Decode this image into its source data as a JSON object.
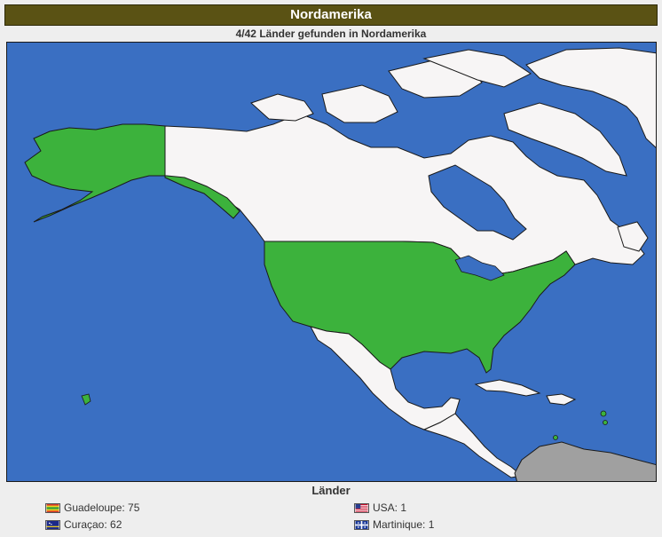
{
  "header": {
    "title": "Nordamerika"
  },
  "status": {
    "text": "4/42 Länder gefunden in Nordamerika"
  },
  "map": {
    "colors": {
      "ocean": "#3a6fc2",
      "found": "#3cb23c",
      "unfound": "#f7f5f5",
      "other": "#a0a0a0",
      "border": "#1a1a1a"
    },
    "found_countries": [
      "USA",
      "Guadeloupe",
      "Curaçao",
      "Martinique"
    ]
  },
  "legend": {
    "title": "Länder",
    "items": [
      {
        "label": "Guadeloupe: 75",
        "flag": "flag-guadeloupe-icon"
      },
      {
        "label": "USA: 1",
        "flag": "flag-usa-icon"
      },
      {
        "label": "Curaçao: 62",
        "flag": "flag-curacao-icon"
      },
      {
        "label": "Martinique: 1",
        "flag": "flag-martinique-icon"
      }
    ]
  }
}
